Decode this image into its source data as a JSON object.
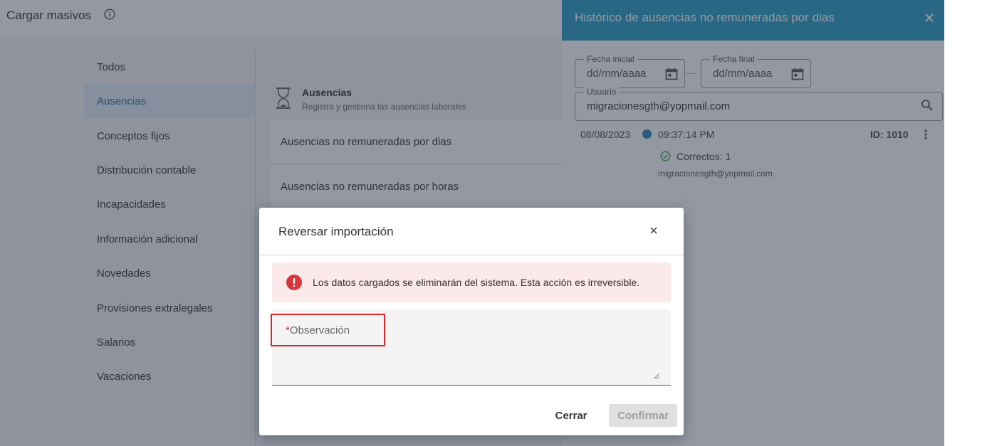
{
  "page": {
    "title": "Cargar masivos",
    "info_icon": "info-circle-icon"
  },
  "left_menu": {
    "items": [
      {
        "label": "Todos",
        "active": false
      },
      {
        "label": "Ausencias",
        "active": true
      },
      {
        "label": "Conceptos fijos",
        "active": false
      },
      {
        "label": "Distribución contable",
        "active": false
      },
      {
        "label": "Incapacidades",
        "active": false
      },
      {
        "label": "Información adicional",
        "active": false
      },
      {
        "label": "Novedades",
        "active": false
      },
      {
        "label": "Provisiones extralegales",
        "active": false
      },
      {
        "label": "Salarios",
        "active": false
      },
      {
        "label": "Vacaciones",
        "active": false
      }
    ]
  },
  "content": {
    "title": "Ausencias",
    "subtitle": "Registra y gestiona las ausencias laborales",
    "rows": [
      "Ausencias no remuneradas por dias",
      "Ausencias no remuneradas por horas"
    ]
  },
  "drawer": {
    "title": "Histórico de ausencias no remuneradas por dias",
    "close_icon": "close-icon",
    "start_date": {
      "label": "Fecha inicial",
      "value": "dd/mm/aaaa"
    },
    "end_date": {
      "label": "Fecha final",
      "value": "dd/mm/aaaa"
    },
    "user": {
      "label": "Usuario",
      "value": "migracionesgth@yopmail.com"
    },
    "history": {
      "date": "08/08/2023",
      "time": "09:37:14 PM",
      "id": "ID: 1010",
      "correct": "Correctos: 1",
      "email": "migracionesgth@yopmail.com"
    }
  },
  "modal": {
    "title": "Reversar importación",
    "alert": "Los datos cargados se eliminarán del sistema. Esta acción es irreversible.",
    "observation": {
      "required_mark": "*",
      "label": "Observación",
      "value": ""
    },
    "cancel_label": "Cerrar",
    "confirm_label": "Confirmar"
  },
  "colors": {
    "accent": "#2a9fc4",
    "alert_bg": "#fce9ea",
    "alert_icon": "#d9353d",
    "highlight": "#d9232d",
    "success": "#4caf50"
  }
}
